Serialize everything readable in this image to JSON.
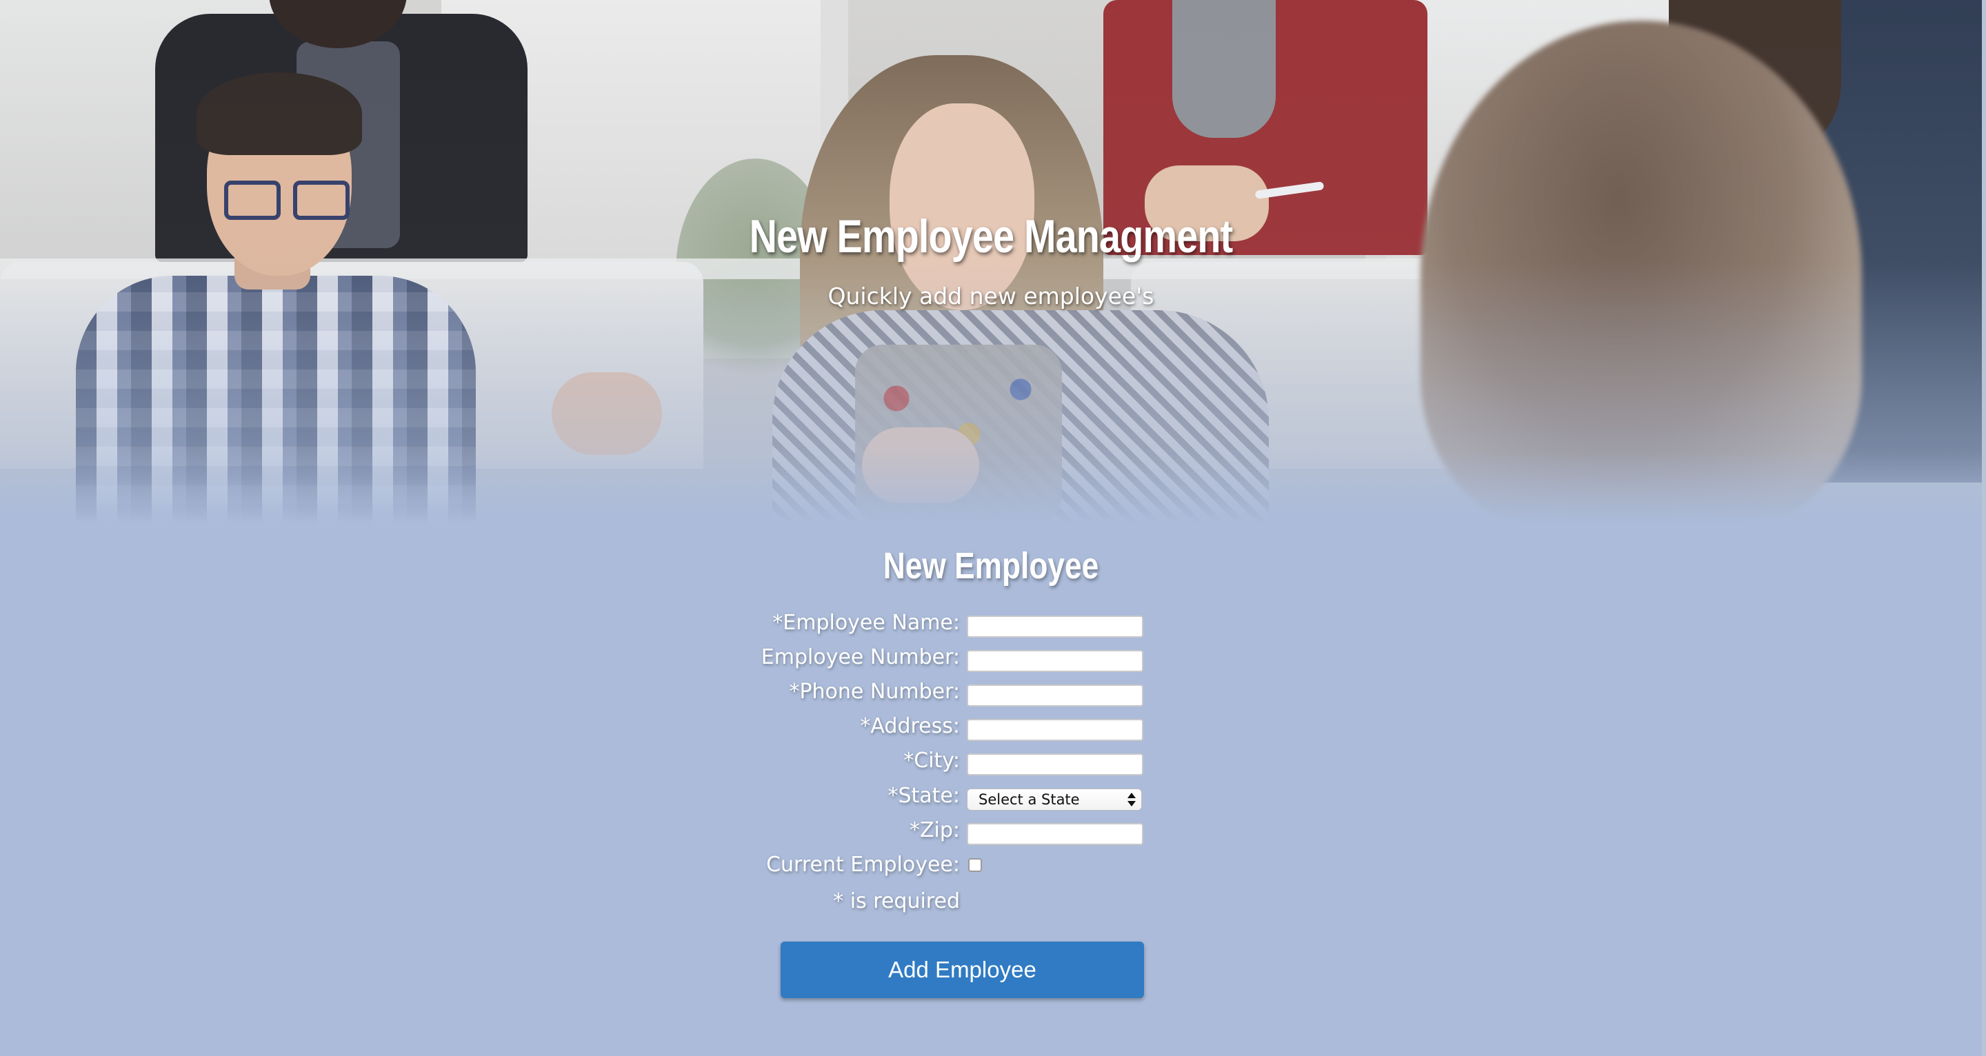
{
  "hero": {
    "title": "New Employee Managment",
    "subtitle": "Quickly add new employee's"
  },
  "form": {
    "heading": "New Employee",
    "fields": [
      {
        "label": "*Employee Name:",
        "type": "text",
        "value": ""
      },
      {
        "label": "Employee Number:",
        "type": "text",
        "value": ""
      },
      {
        "label": "*Phone Number:",
        "type": "text",
        "value": ""
      },
      {
        "label": "*Address:",
        "type": "text",
        "value": ""
      },
      {
        "label": "*City:",
        "type": "text",
        "value": ""
      },
      {
        "label": "*State:",
        "type": "select",
        "selected": "Select a State"
      },
      {
        "label": "*Zip:",
        "type": "text",
        "value": ""
      },
      {
        "label": "Current Employee:",
        "type": "checkbox",
        "checked": false
      }
    ],
    "required_note": "* is required",
    "submit_label": "Add Employee"
  },
  "colors": {
    "background": "#abbbd9",
    "button": "#307bc3",
    "text": "#ffffff"
  }
}
